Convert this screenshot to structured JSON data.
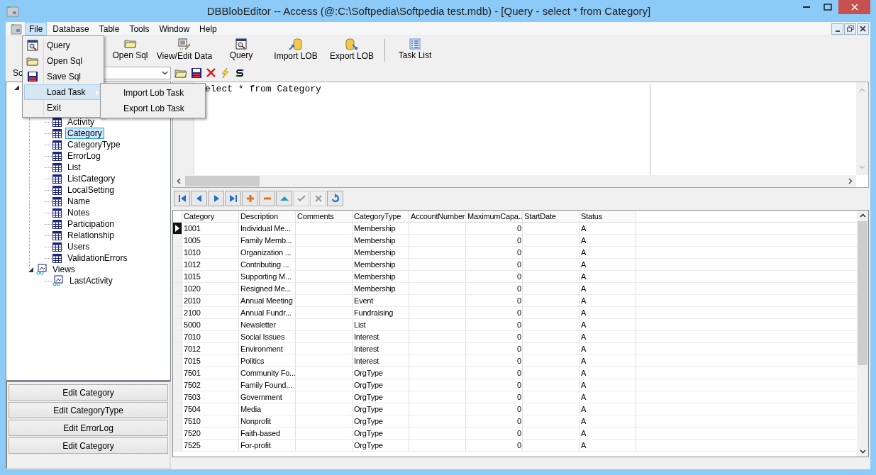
{
  "window": {
    "title": "DBBlobEditor -- Access (@:C:\\Softpedia\\Softpedia test.mdb) - [Query - select * from Category]"
  },
  "menu_bar": [
    {
      "label": "File",
      "selected": true
    },
    {
      "label": "Database",
      "selected": false
    },
    {
      "label": "Table",
      "selected": false
    },
    {
      "label": "Tools",
      "selected": false
    },
    {
      "label": "Window",
      "selected": false
    },
    {
      "label": "Help",
      "selected": false
    }
  ],
  "file_menu": [
    {
      "label": "Query",
      "kind": "query",
      "highlighted": false,
      "has_submenu": false
    },
    {
      "label": "Open Sql",
      "kind": "open",
      "highlighted": false,
      "has_submenu": false
    },
    {
      "label": "Save Sql",
      "kind": "save",
      "highlighted": false,
      "has_submenu": false
    },
    {
      "label": "Load Task",
      "kind": "none",
      "highlighted": true,
      "has_submenu": true
    },
    {
      "label": "Exit",
      "kind": "none",
      "highlighted": false,
      "has_submenu": false
    }
  ],
  "submenu": [
    {
      "label": "Import Lob Task"
    },
    {
      "label": "Export Lob Task"
    }
  ],
  "toolbar": [
    {
      "label": "Open Sql",
      "kind": "open"
    },
    {
      "label": "View/Edit Data",
      "kind": "view-edit"
    },
    {
      "label": "Query",
      "kind": "query"
    },
    {
      "label": "Import LOB",
      "kind": "import"
    },
    {
      "label": "Export LOB",
      "kind": "export"
    },
    {
      "kind": "separator"
    },
    {
      "label": "Task List",
      "kind": "task-list"
    }
  ],
  "schema_selector": {
    "label": "Sc"
  },
  "tree": {
    "expanded": true,
    "children": [
      {
        "kind": "folder",
        "expanded": true,
        "children": [
          {
            "label": "Activity",
            "kind": "table",
            "selected": false
          },
          {
            "label": "Category",
            "kind": "table",
            "selected": true
          },
          {
            "label": "CategoryType",
            "kind": "table",
            "selected": false
          },
          {
            "label": "ErrorLog",
            "kind": "table",
            "selected": false
          },
          {
            "label": "List",
            "kind": "table",
            "selected": false
          },
          {
            "label": "ListCategory",
            "kind": "table",
            "selected": false
          },
          {
            "label": "LocalSetting",
            "kind": "table",
            "selected": false
          },
          {
            "label": "Name",
            "kind": "table",
            "selected": false
          },
          {
            "label": "Notes",
            "kind": "table",
            "selected": false
          },
          {
            "label": "Participation",
            "kind": "table",
            "selected": false
          },
          {
            "label": "Relationship",
            "kind": "table",
            "selected": false
          },
          {
            "label": "Users",
            "kind": "table",
            "selected": false
          },
          {
            "label": "ValidationErrors",
            "kind": "table",
            "selected": false
          }
        ]
      },
      {
        "label": "Views",
        "kind": "views",
        "expanded": true,
        "children": [
          {
            "label": "LastActivity",
            "kind": "view",
            "selected": false
          }
        ]
      }
    ]
  },
  "edit_buttons": [
    "Edit Category",
    "Edit CategoryType",
    "Edit ErrorLog",
    "Edit Category"
  ],
  "sql_editor": {
    "text": "elect * from Category"
  },
  "navigator": [
    {
      "kind": "first",
      "disabled": false
    },
    {
      "kind": "prior",
      "disabled": false
    },
    {
      "kind": "next",
      "disabled": false
    },
    {
      "kind": "last",
      "disabled": false
    },
    {
      "kind": "insert",
      "disabled": false
    },
    {
      "kind": "delete",
      "disabled": false
    },
    {
      "kind": "edit",
      "disabled": false
    },
    {
      "kind": "post",
      "disabled": true
    },
    {
      "kind": "cancel",
      "disabled": true
    },
    {
      "kind": "refresh",
      "disabled": false
    }
  ],
  "grid": {
    "columns": [
      {
        "label": "Category"
      },
      {
        "label": "Description"
      },
      {
        "label": "Comments"
      },
      {
        "label": "CategoryType"
      },
      {
        "label": "AccountNumber"
      },
      {
        "label": "MaximumCapa..."
      },
      {
        "label": "StartDate"
      },
      {
        "label": "Status"
      }
    ],
    "rows": [
      {
        "selected": true,
        "cells": [
          "1001",
          "Individual Me...",
          "",
          "Membership",
          "",
          "0",
          "",
          "A"
        ]
      },
      {
        "selected": false,
        "cells": [
          "1005",
          "Family Memb...",
          "",
          "Membership",
          "",
          "0",
          "",
          "A"
        ]
      },
      {
        "selected": false,
        "cells": [
          "1010",
          "Organization ...",
          "",
          "Membership",
          "",
          "0",
          "",
          "A"
        ]
      },
      {
        "selected": false,
        "cells": [
          "1012",
          "Contributing ...",
          "",
          "Membership",
          "",
          "0",
          "",
          "A"
        ]
      },
      {
        "selected": false,
        "cells": [
          "1015",
          "Supporting M...",
          "",
          "Membership",
          "",
          "0",
          "",
          "A"
        ]
      },
      {
        "selected": false,
        "cells": [
          "1020",
          "Resigned Me...",
          "",
          "Membership",
          "",
          "0",
          "",
          "A"
        ]
      },
      {
        "selected": false,
        "cells": [
          "2010",
          "Annual Meeting",
          "",
          "Event",
          "",
          "0",
          "",
          "A"
        ]
      },
      {
        "selected": false,
        "cells": [
          "2100",
          "Annual Fundr...",
          "",
          "Fundraising",
          "",
          "0",
          "",
          "A"
        ]
      },
      {
        "selected": false,
        "cells": [
          "5000",
          "Newsletter",
          "",
          "List",
          "",
          "0",
          "",
          "A"
        ]
      },
      {
        "selected": false,
        "cells": [
          "7010",
          "Social Issues",
          "",
          "Interest",
          "",
          "0",
          "",
          "A"
        ]
      },
      {
        "selected": false,
        "cells": [
          "7012",
          "Environment",
          "",
          "Interest",
          "",
          "0",
          "",
          "A"
        ]
      },
      {
        "selected": false,
        "cells": [
          "7015",
          "Politics",
          "",
          "Interest",
          "",
          "0",
          "",
          "A"
        ]
      },
      {
        "selected": false,
        "cells": [
          "7501",
          "Community Fo...",
          "",
          "OrgType",
          "",
          "0",
          "",
          "A"
        ]
      },
      {
        "selected": false,
        "cells": [
          "7502",
          "Family Found...",
          "",
          "OrgType",
          "",
          "0",
          "",
          "A"
        ]
      },
      {
        "selected": false,
        "cells": [
          "7503",
          "Government",
          "",
          "OrgType",
          "",
          "0",
          "",
          "A"
        ]
      },
      {
        "selected": false,
        "cells": [
          "7504",
          "Media",
          "",
          "OrgType",
          "",
          "0",
          "",
          "A"
        ]
      },
      {
        "selected": false,
        "cells": [
          "7510",
          "Nonprofit",
          "",
          "OrgType",
          "",
          "0",
          "",
          "A"
        ]
      },
      {
        "selected": false,
        "cells": [
          "7520",
          "Faith-based",
          "",
          "OrgType",
          "",
          "0",
          "",
          "A"
        ]
      },
      {
        "selected": false,
        "cells": [
          "7525",
          "For-profit",
          "",
          "OrgType",
          "",
          "0",
          "",
          "A"
        ]
      }
    ]
  }
}
